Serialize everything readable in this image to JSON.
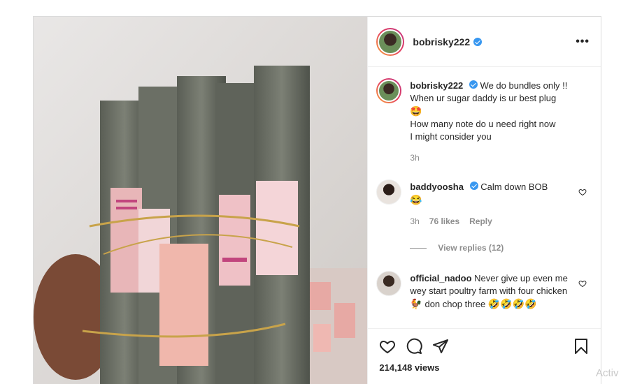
{
  "post": {
    "username": "bobrisky222",
    "more_label": "•••",
    "caption": {
      "username": "bobrisky222",
      "line1": "We do bundles only !!",
      "line2": "When ur sugar daddy is ur best plug",
      "emoji": "🤩",
      "line3": "How many note do u need right now",
      "line4": "I might consider you",
      "time": "3h"
    },
    "comments": [
      {
        "username": "baddyoosha",
        "verified": true,
        "text": "Calm down BOB",
        "emoji": "😂",
        "time": "3h",
        "likes": "76 likes",
        "reply": "Reply",
        "view_replies": "View replies (12)"
      },
      {
        "username": "official_nadoo",
        "verified": false,
        "text": "Never give up even me wey start poultry farm with four chicken",
        "emoji_mid": "🐓",
        "text2": "don chop three",
        "emoji_end": "🤣🤣🤣🤣"
      }
    ],
    "views": "214,148 views"
  },
  "overlay": {
    "watermark": "Activ"
  },
  "icons": [
    "heart-icon",
    "comment-icon",
    "share-icon",
    "bookmark-icon",
    "verified-badge-icon",
    "more-icon"
  ]
}
